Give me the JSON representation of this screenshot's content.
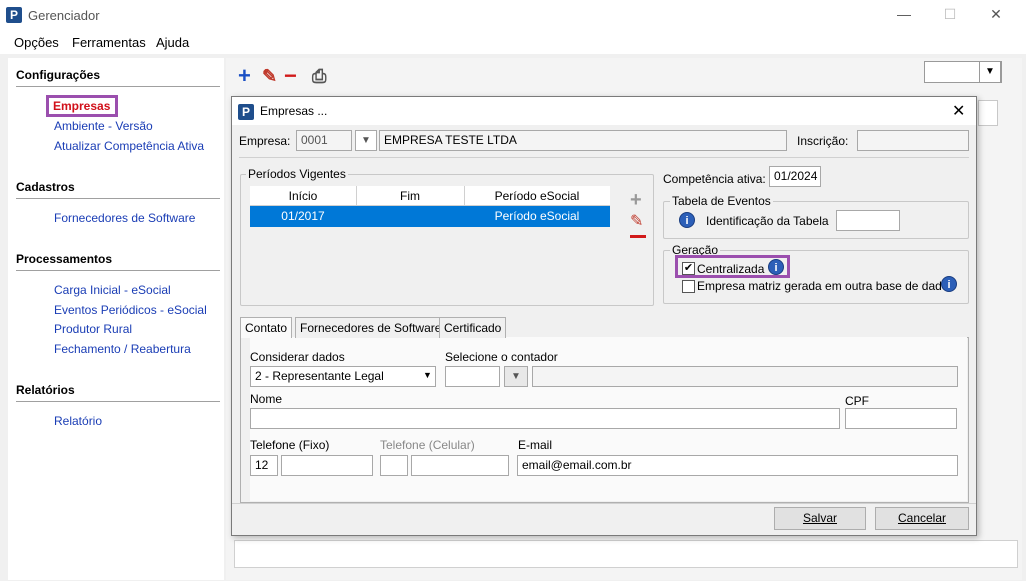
{
  "window": {
    "title": "Gerenciador",
    "logo": "P"
  },
  "menu": [
    "Opções",
    "Ferramentas",
    "Ajuda"
  ],
  "sidebar": {
    "sections": [
      {
        "title": "Configurações",
        "items": [
          "Empresas",
          "Ambiente - Versão",
          "Atualizar Competência Ativa"
        ]
      },
      {
        "title": "Cadastros",
        "items": [
          "Fornecedores de Software"
        ]
      },
      {
        "title": "Processamentos",
        "items": [
          "Carga Inicial - eSocial",
          "Eventos Periódicos - eSocial",
          "Produtor Rural",
          "Fechamento / Reabertura"
        ]
      },
      {
        "title": "Relatórios",
        "items": [
          "Relatório"
        ]
      }
    ]
  },
  "toolbar": {
    "add": "+",
    "edit": "✎",
    "remove": "−",
    "print": "⎙"
  },
  "dialog": {
    "title": "Empresas ...",
    "empresa_label": "Empresa:",
    "empresa_code": "0001",
    "empresa_name": "EMPRESA TESTE LTDA",
    "inscricao_label": "Inscrição:",
    "periodos_title": "Períodos Vigentes",
    "columns": [
      "Início",
      "Fim",
      "Período eSocial"
    ],
    "rows": [
      {
        "inicio": "01/2017",
        "fim": "",
        "periodo": "Período eSocial"
      }
    ],
    "competencia_label": "Competência ativa:",
    "competencia_value": "01/2024",
    "tabela_title": "Tabela de Eventos",
    "tabela_label": "Identificação da Tabela",
    "geracao_title": "Geração",
    "centralizada_label": "Centralizada",
    "matriz_label": "Empresa matriz gerada em outra base de dados",
    "tabs": [
      "Contato",
      "Fornecedores de Software",
      "Certificado"
    ],
    "considerar_label": "Considerar dados",
    "considerar_value": "2 - Representante Legal",
    "contador_label": "Selecione o contador",
    "nome_label": "Nome",
    "cpf_label": "CPF",
    "tel_fixo_label": "Telefone (Fixo)",
    "tel_fixo_ddd": "12",
    "tel_cel_label": "Telefone (Celular)",
    "email_label": "E-mail",
    "email_value": "email@email.com.br",
    "salvar": "Salvar",
    "cancelar": "Cancelar"
  },
  "colors": {
    "link": "#1a3db5",
    "selected": "#d1101a",
    "highlight_border": "#9b4fae",
    "row_selected": "#0078d7"
  }
}
